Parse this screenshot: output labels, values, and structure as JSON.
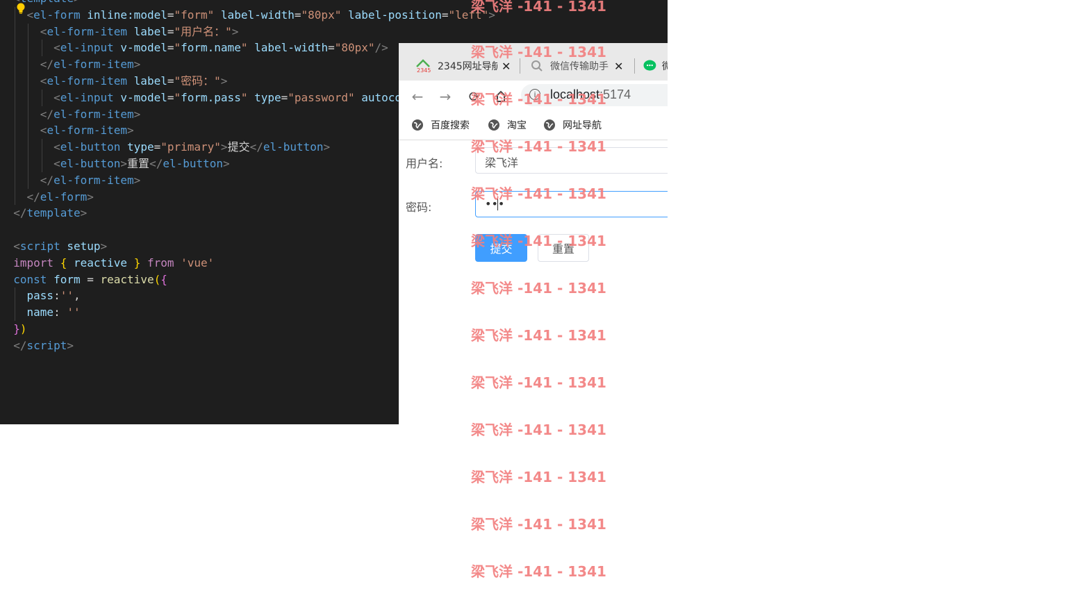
{
  "editor": {
    "lines": [
      [
        [
          "t-punc",
          "<"
        ],
        [
          "t-tag",
          "template"
        ],
        [
          "t-punc",
          ">"
        ]
      ],
      [
        [
          "t-txt",
          "  "
        ],
        [
          "t-punc",
          "<"
        ],
        [
          "t-tag",
          "el-form"
        ],
        [
          "t-txt",
          " "
        ],
        [
          "t-attr",
          "inline:model"
        ],
        [
          "t-txt",
          "="
        ],
        [
          "t-str",
          "\"form\""
        ],
        [
          "t-txt",
          " "
        ],
        [
          "t-attr",
          "label-width"
        ],
        [
          "t-txt",
          "="
        ],
        [
          "t-str",
          "\"80px\""
        ],
        [
          "t-txt",
          " "
        ],
        [
          "t-attr",
          "label-position"
        ],
        [
          "t-txt",
          "="
        ],
        [
          "t-str",
          "\"left\""
        ],
        [
          "t-punc",
          ">"
        ]
      ],
      [
        [
          "t-txt",
          "    "
        ],
        [
          "t-punc",
          "<"
        ],
        [
          "t-tag",
          "el-form-item"
        ],
        [
          "t-txt",
          " "
        ],
        [
          "t-attr",
          "label"
        ],
        [
          "t-txt",
          "="
        ],
        [
          "t-str",
          "\"用户名：\""
        ],
        [
          "t-punc",
          ">"
        ]
      ],
      [
        [
          "t-txt",
          "      "
        ],
        [
          "t-punc",
          "<"
        ],
        [
          "t-tag",
          "el-input"
        ],
        [
          "t-txt",
          " "
        ],
        [
          "t-attr",
          "v-model"
        ],
        [
          "t-txt",
          "="
        ],
        [
          "t-str",
          "\""
        ],
        [
          "t-attr",
          "form.name"
        ],
        [
          "t-str",
          "\""
        ],
        [
          "t-txt",
          " "
        ],
        [
          "t-attr",
          "label-width"
        ],
        [
          "t-txt",
          "="
        ],
        [
          "t-str",
          "\"80px\""
        ],
        [
          "t-punc",
          "/>"
        ]
      ],
      [
        [
          "t-txt",
          "    "
        ],
        [
          "t-punc",
          "</"
        ],
        [
          "t-tag",
          "el-form-item"
        ],
        [
          "t-punc",
          ">"
        ]
      ],
      [
        [
          "t-txt",
          "    "
        ],
        [
          "t-punc",
          "<"
        ],
        [
          "t-tag",
          "el-form-item"
        ],
        [
          "t-txt",
          " "
        ],
        [
          "t-attr",
          "label"
        ],
        [
          "t-txt",
          "="
        ],
        [
          "t-str",
          "\"密码：\""
        ],
        [
          "t-punc",
          ">"
        ]
      ],
      [
        [
          "t-txt",
          "      "
        ],
        [
          "t-punc",
          "<"
        ],
        [
          "t-tag",
          "el-input"
        ],
        [
          "t-txt",
          " "
        ],
        [
          "t-attr",
          "v-model"
        ],
        [
          "t-txt",
          "="
        ],
        [
          "t-str",
          "\""
        ],
        [
          "t-attr",
          "form.pass"
        ],
        [
          "t-str",
          "\""
        ],
        [
          "t-txt",
          " "
        ],
        [
          "t-attr",
          "type"
        ],
        [
          "t-txt",
          "="
        ],
        [
          "t-str",
          "\"password\""
        ],
        [
          "t-txt",
          " "
        ],
        [
          "t-attr",
          "autoco"
        ]
      ],
      [
        [
          "t-txt",
          "    "
        ],
        [
          "t-punc",
          "</"
        ],
        [
          "t-tag",
          "el-form-item"
        ],
        [
          "t-punc",
          ">"
        ]
      ],
      [
        [
          "t-txt",
          "    "
        ],
        [
          "t-punc",
          "<"
        ],
        [
          "t-tag",
          "el-form-item"
        ],
        [
          "t-punc",
          ">"
        ]
      ],
      [
        [
          "t-txt",
          "      "
        ],
        [
          "t-punc",
          "<"
        ],
        [
          "t-tag",
          "el-button"
        ],
        [
          "t-txt",
          " "
        ],
        [
          "t-attr",
          "type"
        ],
        [
          "t-txt",
          "="
        ],
        [
          "t-str",
          "\"primary\""
        ],
        [
          "t-punc",
          ">"
        ],
        [
          "t-txt",
          "提交"
        ],
        [
          "t-punc",
          "</"
        ],
        [
          "t-tag",
          "el-button"
        ],
        [
          "t-punc",
          ">"
        ]
      ],
      [
        [
          "t-txt",
          "      "
        ],
        [
          "t-punc",
          "<"
        ],
        [
          "t-tag",
          "el-button"
        ],
        [
          "t-punc",
          ">"
        ],
        [
          "t-txt",
          "重置"
        ],
        [
          "t-punc",
          "</"
        ],
        [
          "t-tag",
          "el-button"
        ],
        [
          "t-punc",
          ">"
        ]
      ],
      [
        [
          "t-txt",
          "    "
        ],
        [
          "t-punc",
          "</"
        ],
        [
          "t-tag",
          "el-form-item"
        ],
        [
          "t-punc",
          ">"
        ]
      ],
      [
        [
          "t-txt",
          "  "
        ],
        [
          "t-punc",
          "</"
        ],
        [
          "t-tag",
          "el-form"
        ],
        [
          "t-punc",
          ">"
        ]
      ],
      [
        [
          "t-punc",
          "</"
        ],
        [
          "t-tag",
          "template"
        ],
        [
          "t-punc",
          ">"
        ]
      ],
      [],
      [
        [
          "t-punc",
          "<"
        ],
        [
          "t-tag",
          "script"
        ],
        [
          "t-txt",
          " "
        ],
        [
          "t-attr",
          "setup"
        ],
        [
          "t-punc",
          ">"
        ]
      ],
      [
        [
          "t-kw",
          "import"
        ],
        [
          "t-txt",
          " "
        ],
        [
          "t-brace1",
          "{"
        ],
        [
          "t-txt",
          " "
        ],
        [
          "t-attr",
          "reactive"
        ],
        [
          "t-txt",
          " "
        ],
        [
          "t-brace1",
          "}"
        ],
        [
          "t-txt",
          " "
        ],
        [
          "t-kw",
          "from"
        ],
        [
          "t-txt",
          " "
        ],
        [
          "t-str",
          "'vue'"
        ]
      ],
      [
        [
          "t-tag",
          "const"
        ],
        [
          "t-txt",
          " "
        ],
        [
          "t-attr",
          "form"
        ],
        [
          "t-txt",
          " = "
        ],
        [
          "t-fn",
          "reactive"
        ],
        [
          "t-brace1",
          "("
        ],
        [
          "t-brace2",
          "{"
        ]
      ],
      [
        [
          "t-txt",
          "  "
        ],
        [
          "t-attr",
          "pass"
        ],
        [
          "t-txt",
          ":"
        ],
        [
          "t-str",
          "''"
        ],
        [
          "t-txt",
          ","
        ]
      ],
      [
        [
          "t-txt",
          "  "
        ],
        [
          "t-attr",
          "name"
        ],
        [
          "t-txt",
          ": "
        ],
        [
          "t-str",
          "''"
        ]
      ],
      [
        [
          "t-brace2",
          "}"
        ],
        [
          "t-brace1",
          ")"
        ]
      ],
      [
        [
          "t-punc",
          "</"
        ],
        [
          "t-tag",
          "script"
        ],
        [
          "t-punc",
          ">"
        ]
      ]
    ]
  },
  "browser": {
    "tabs": [
      {
        "label": "2345网址导航",
        "close": "✕"
      },
      {
        "label": "微信传输助手",
        "close": "✕"
      },
      {
        "label": "微"
      }
    ],
    "url_host": "localhost",
    "url_port": ":5174",
    "bookmarks": [
      "百度搜索",
      "淘宝",
      "网址导航"
    ]
  },
  "form": {
    "username_label": "用户名:",
    "username_value": "梁飞洋",
    "password_label": "密码:",
    "password_value": "•••",
    "submit_label": "提交",
    "reset_label": "重置"
  },
  "watermark": "梁飞洋 -141 - 1341",
  "colors": {
    "primary": "#409eff",
    "watermark": "#f28080",
    "editor_bg": "#1e1e1e"
  }
}
